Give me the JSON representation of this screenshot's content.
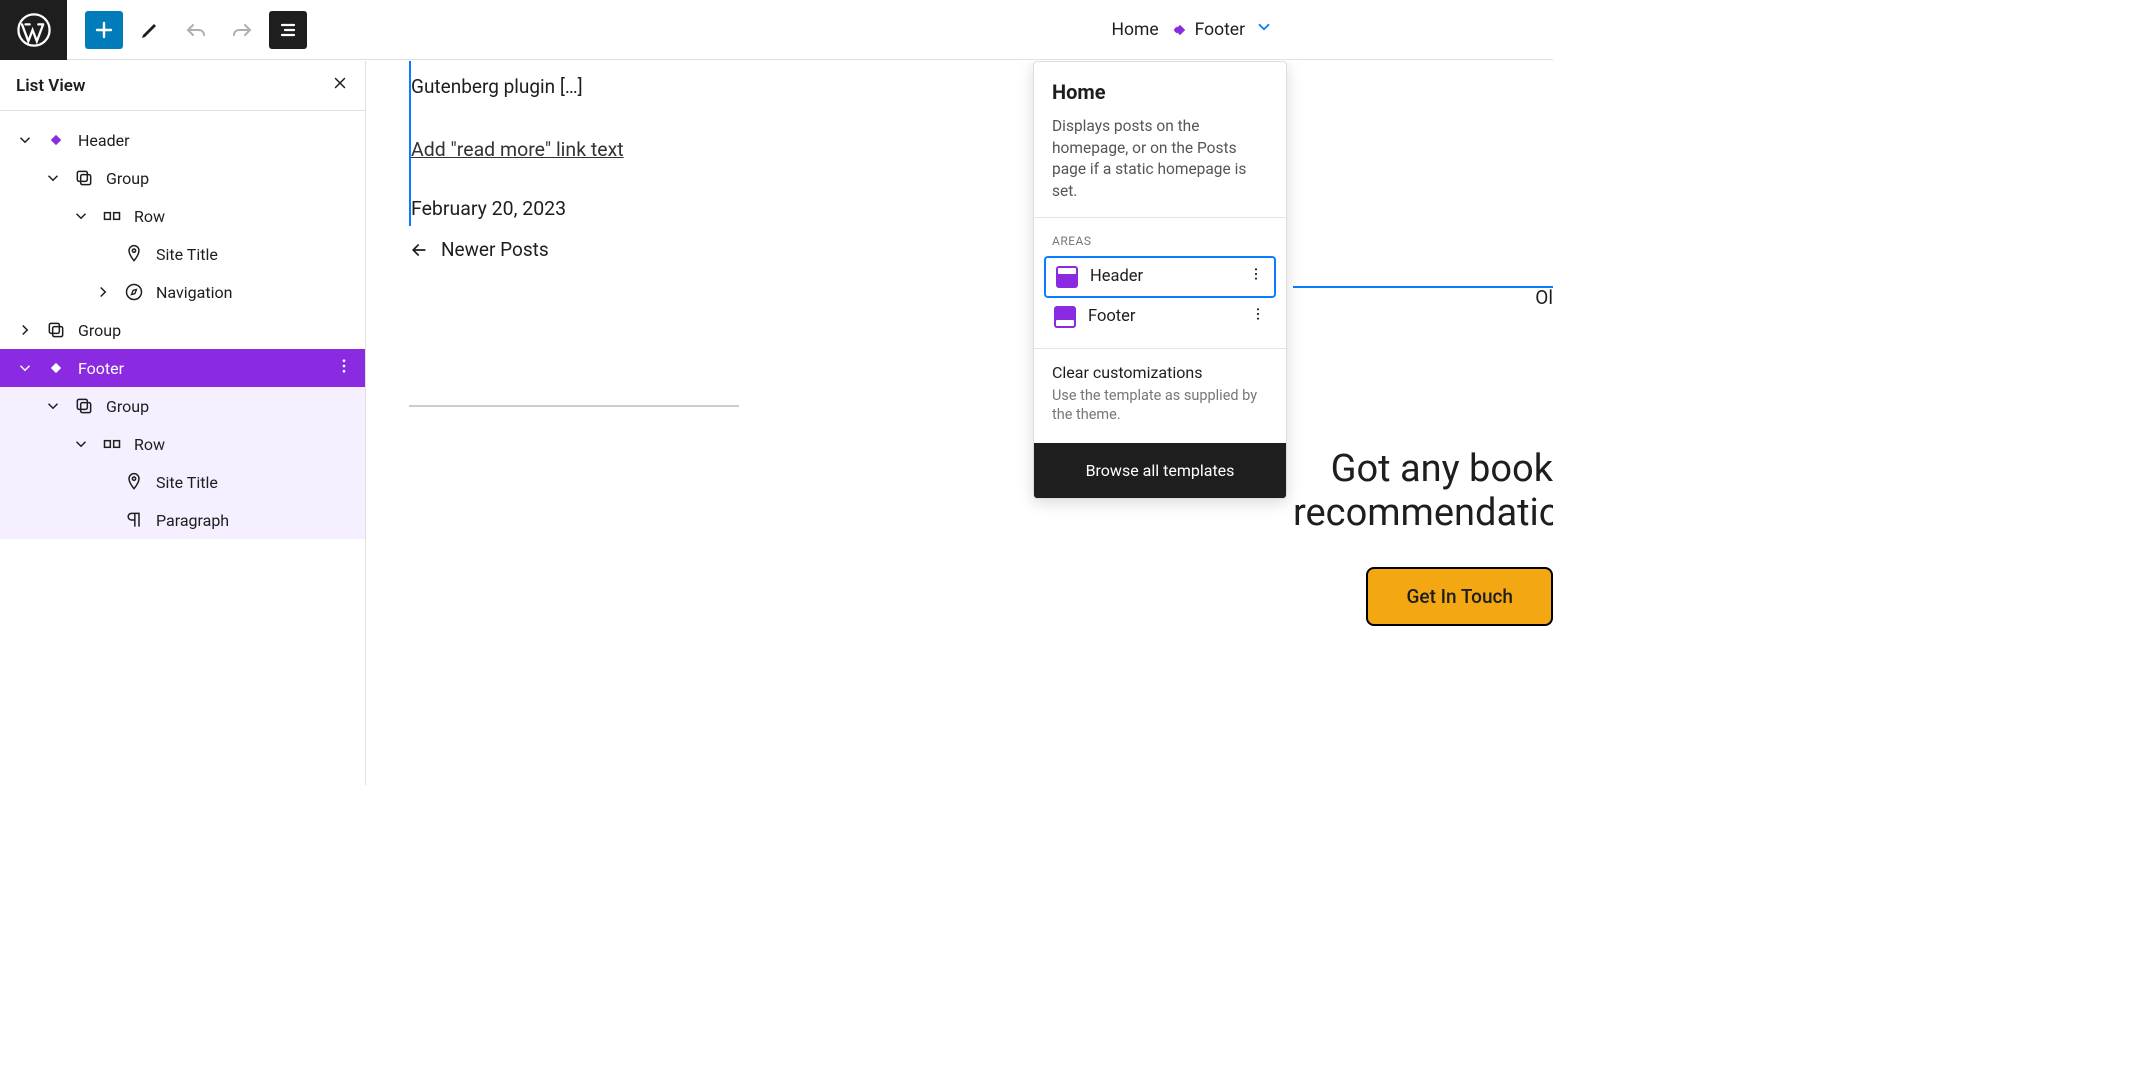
{
  "toolbar": {
    "breadcrumb_home": "Home",
    "breadcrumb_current": "Footer"
  },
  "list_view": {
    "title": "List View",
    "items": {
      "header": "Header",
      "group1": "Group",
      "row1": "Row",
      "site_title1": "Site Title",
      "navigation": "Navigation",
      "group2": "Group",
      "footer": "Footer",
      "group3": "Group",
      "row2": "Row",
      "site_title2": "Site Title",
      "paragraph": "Paragraph"
    }
  },
  "canvas": {
    "post_title": "Gutenberg plugin […]",
    "read_more": "Add \"read more\" link text",
    "date": "February 20, 2023",
    "newer": "Newer Posts",
    "ol": "Ol",
    "footer_line1": "Got any book",
    "footer_line2": "recommendation",
    "cta": "Get In Touch"
  },
  "popover": {
    "title": "Home",
    "desc": "Displays posts on the homepage, or on the Posts page if a static homepage is set.",
    "areas_label": "AREAS",
    "area_header": "Header",
    "area_footer": "Footer",
    "clear_title": "Clear customizations",
    "clear_desc": "Use the template as supplied by the theme.",
    "browse": "Browse all templates"
  }
}
